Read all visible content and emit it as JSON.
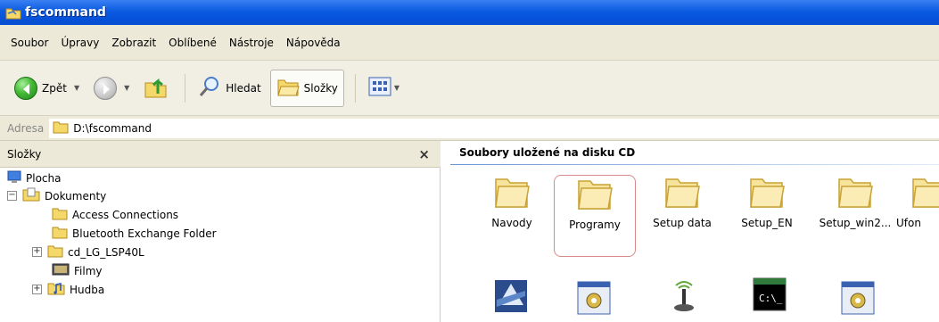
{
  "window": {
    "title": "fscommand"
  },
  "menu": [
    "Soubor",
    "Úpravy",
    "Zobrazit",
    "Oblíbené",
    "Nástroje",
    "Nápověda"
  ],
  "toolbar": {
    "back_label": "Zpět",
    "search_label": "Hledat",
    "folders_label": "Složky"
  },
  "address": {
    "label": "Adresa",
    "path": "D:\\fscommand"
  },
  "folders_panel": {
    "title": "Složky",
    "close_symbol": "×",
    "items": [
      {
        "label": "Plocha",
        "icon": "desktop-icon"
      },
      {
        "label": "Dokumenty",
        "icon": "documents-folder-icon",
        "expander": "−"
      },
      {
        "label": "Access Connections",
        "icon": "folder-icon"
      },
      {
        "label": "Bluetooth Exchange Folder",
        "icon": "folder-icon"
      },
      {
        "label": "cd_LG_LSP40L",
        "icon": "folder-icon",
        "expander": "+"
      },
      {
        "label": "Filmy",
        "icon": "video-folder-icon"
      },
      {
        "label": "Hudba",
        "icon": "music-folder-icon",
        "expander": "+"
      }
    ]
  },
  "content": {
    "group_title": "Soubory uložené na disku CD",
    "folders": [
      {
        "label": "Navody",
        "selected": false
      },
      {
        "label": "Programy",
        "selected": true
      },
      {
        "label": "Setup data",
        "selected": false
      },
      {
        "label": "Setup_EN",
        "selected": false
      },
      {
        "label": "Setup_win2...",
        "selected": false
      },
      {
        "label": "Ufon",
        "selected": false
      }
    ],
    "second_row_icons": [
      "installer-icon",
      "application-window-icon",
      "joystick-icon",
      "console-icon",
      "application-window-icon"
    ]
  },
  "colors": {
    "titlebar": "#0a5ae0",
    "toolbar_bg": "#ece9d8",
    "folder_fill": "#f7e49c",
    "folder_stroke": "#c8a233",
    "selection_border": "#d88a8a"
  }
}
